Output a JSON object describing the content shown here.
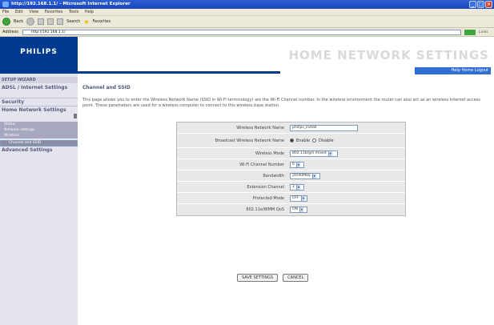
{
  "window": {
    "title": "http://192.168.1.1/ - Microsoft Internet Explorer",
    "buttons": [
      "_",
      "□",
      "✕"
    ]
  },
  "menu": [
    "File",
    "Edit",
    "View",
    "Favorites",
    "Tools",
    "Help"
  ],
  "toolbar": {
    "back_label": "Back",
    "search_label": "Search",
    "favorites_label": "Favorites"
  },
  "address": {
    "label": "Address",
    "url": "http://192.168.1.1/",
    "go_label": "Go",
    "links_label": "Links"
  },
  "brand": {
    "logo": "PHILIPS",
    "banner_title": "HOME NETWORK SETTINGS",
    "help_bar": "Help  Home  Logout"
  },
  "sidebar": {
    "setup_label": "SETUP WIZARD",
    "items": [
      "ADSL / Internet Settings",
      "Security",
      "Home Network Settings"
    ],
    "subitems": [
      "Status",
      "Network settings",
      "Wireless",
      "Channel and SSID"
    ],
    "advanced": "Advanced Settings"
  },
  "content": {
    "title": "Channel and SSID",
    "description": "This page allows you to enter the Wireless Network Name (SSID in Wi-Fi terminology) are the Wi-Fi Channel number. In the wireless environment the router can also act as an wireless internet access point. These parameters are used for a wireless computer to connect to this wireless base station."
  },
  "form": {
    "ssid": {
      "label": "Wireless Network Name",
      "value": "philips_install"
    },
    "broadcast": {
      "label": "Broadcast Wireless Network Name",
      "enable": "Enable",
      "disable": "Disable"
    },
    "mode": {
      "label": "Wireless Mode",
      "value": "802.11b/g/n mixed"
    },
    "channel": {
      "label": "Wi-Fi Channel Number",
      "value": "6"
    },
    "bandwidth": {
      "label": "Bandwidth",
      "value": "20/40MHz"
    },
    "ext_channel": {
      "label": "Extension Channel",
      "value": "2"
    },
    "protected": {
      "label": "Protected Mode",
      "value": "OFF"
    },
    "wmm": {
      "label": "802.11e/WMM QoS",
      "value": "ON"
    }
  },
  "buttons": {
    "save": "SAVE SETTINGS",
    "cancel": "CANCEL"
  },
  "colors": {
    "brand_blue": "#003a8f",
    "sidebar_bg": "#e4e4ee",
    "form_bg": "#e8e8e8"
  }
}
